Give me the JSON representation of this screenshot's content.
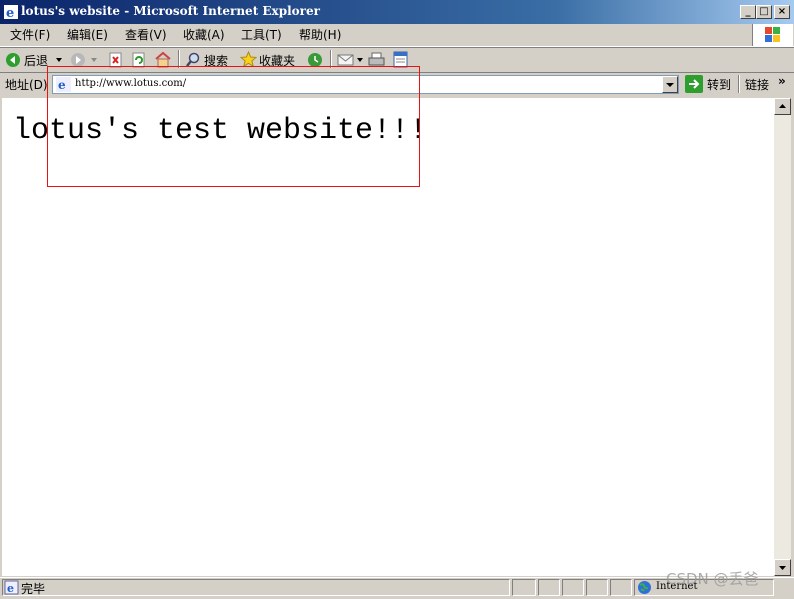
{
  "window": {
    "title": "lotus's website - Microsoft Internet Explorer",
    "minimize": "_",
    "maximize": "□",
    "close": "×"
  },
  "menu": {
    "items": [
      "文件(F)",
      "编辑(E)",
      "查看(V)",
      "收藏(A)",
      "工具(T)",
      "帮助(H)"
    ]
  },
  "toolbar": {
    "back": "后退",
    "search": "搜索",
    "favorites": "收藏夹"
  },
  "address": {
    "label": "地址(D)",
    "url": "http://www.lotus.com/",
    "go": "转到",
    "links": "链接",
    "more": "»"
  },
  "page": {
    "heading": "lotus's test website!!!"
  },
  "status": {
    "text": "完毕",
    "zone": "Internet"
  },
  "watermark": "CSDN @丢爸",
  "colors": {
    "titlebar": "#0a246a",
    "highlight_box": "#e11111"
  }
}
